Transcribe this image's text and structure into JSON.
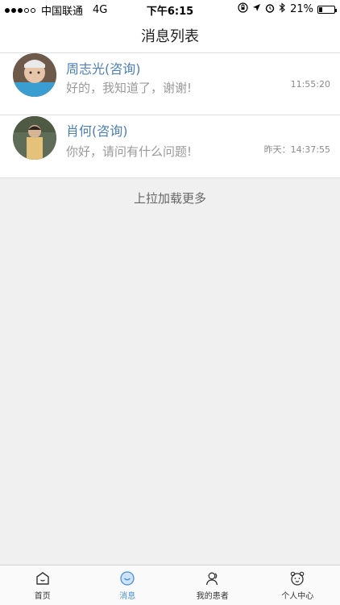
{
  "status_bar": {
    "carrier": "中国联通",
    "network": "4G",
    "time": "下午6:15",
    "battery": "21%",
    "battery_level": 0.21
  },
  "header": {
    "title": "消息列表"
  },
  "messages": [
    {
      "name": "周志光(咨询)",
      "text": "好的，我知道了，谢谢!",
      "time": "11:55:20",
      "avatar_icon": "child-photo"
    },
    {
      "name": "肖何(咨询)",
      "text": "你好，请问有什么问题!",
      "time": "昨天：14:37:55",
      "avatar_icon": "child-photo"
    }
  ],
  "load_more": "上拉加载更多",
  "tabs": [
    {
      "label": "首页",
      "icon": "home-icon"
    },
    {
      "label": "消息",
      "icon": "message-icon"
    },
    {
      "label": "我的患者",
      "icon": "patients-icon"
    },
    {
      "label": "个人中心",
      "icon": "profile-icon"
    }
  ],
  "colors": {
    "accent": "#4a90d9",
    "name": "#4a7fb8"
  }
}
